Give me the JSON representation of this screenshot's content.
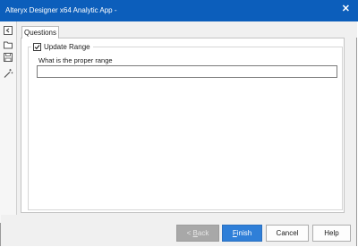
{
  "window": {
    "title": "Alteryx Designer x64 Analytic App -",
    "close_glyph": "✕"
  },
  "toolbar": {
    "icons": [
      "open-app-icon",
      "folder-icon",
      "save-icon",
      "magic-wand-icon"
    ]
  },
  "tabs": [
    {
      "label": "Questions",
      "selected": true
    }
  ],
  "questions": {
    "group_checkbox_label": "Update Range",
    "group_checked": true,
    "question_label": "What is the proper range",
    "answer_value": ""
  },
  "footer": {
    "back_accel": "B",
    "back_rest": "ack",
    "back_prefix": "< ",
    "finish_accel": "F",
    "finish_rest": "inish",
    "cancel_label": "Cancel",
    "help_label": "Help"
  },
  "colors": {
    "titlebar": "#0c5ebb",
    "primary_button": "#2f7fd8",
    "disabled_button": "#a8a8a8"
  }
}
